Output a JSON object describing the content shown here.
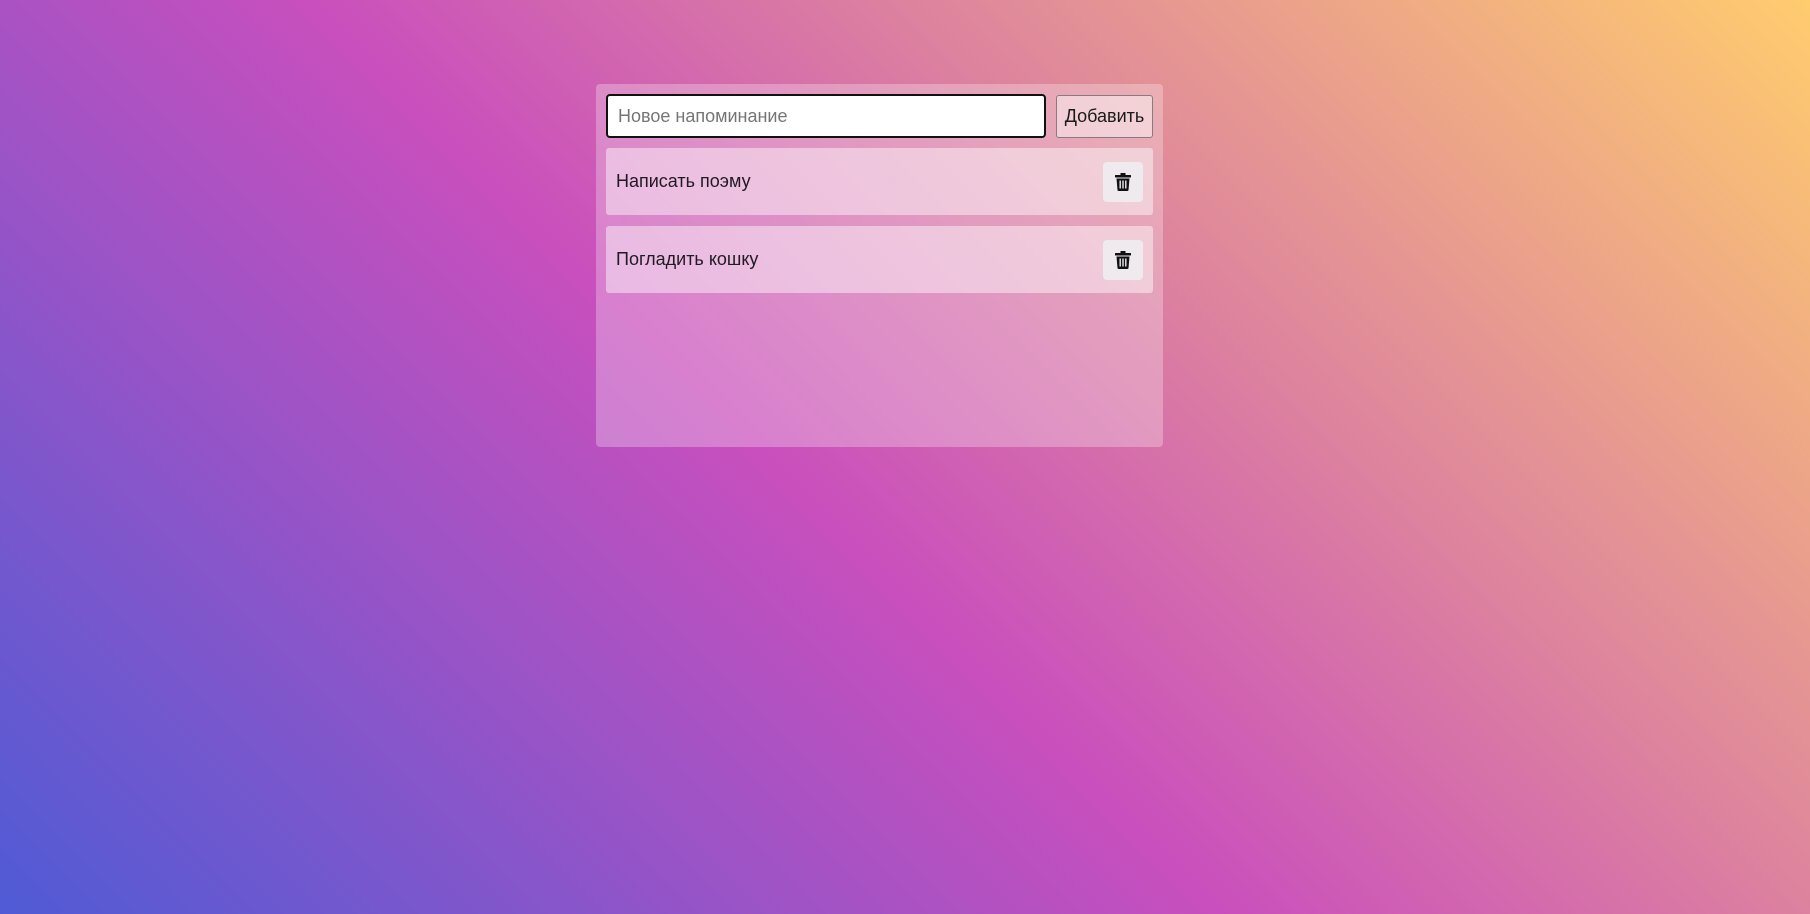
{
  "form": {
    "input_placeholder": "Новое напоминание",
    "input_value": "",
    "add_label": "Добавить"
  },
  "todos": [
    {
      "text": "Написать поэму",
      "delete_icon": "trash-icon"
    },
    {
      "text": "Погладить кошку",
      "delete_icon": "trash-icon"
    }
  ]
}
